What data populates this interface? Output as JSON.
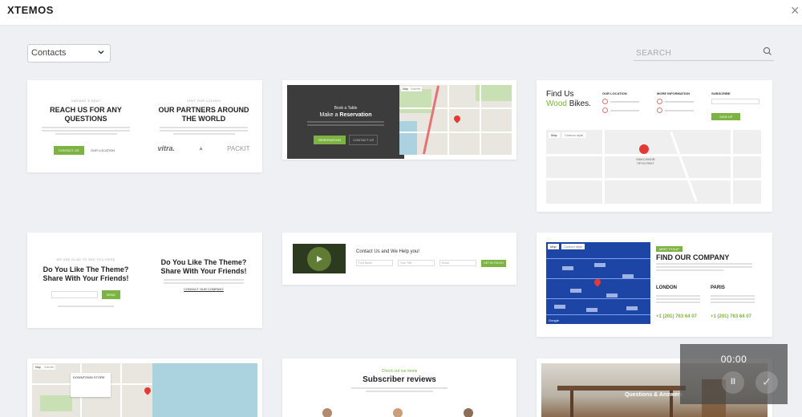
{
  "header": {
    "brand": "XTEMOS",
    "close_glyph": "×"
  },
  "filter": {
    "selected": "Contacts"
  },
  "search": {
    "placeholder": "SEARCH"
  },
  "cards": {
    "c1": {
      "left": {
        "kicker": "VARIANT X-SEAT",
        "title": "REACH US FOR ANY QUESTIONS",
        "primary_btn": "CONTACT US",
        "secondary_btn": "OUR LOCATION"
      },
      "right": {
        "kicker": "VISIT OUR LOCHES",
        "title": "OUR PARTNERS AROUND THE WORLD",
        "logos": [
          "vitra.",
          "▲",
          "PACKIT"
        ]
      }
    },
    "c2": {
      "small": "Book a Table",
      "title_pre": "Make a ",
      "title_bold": "Reservation",
      "btn1": "RESERVATION",
      "btn2": "CONTACT US",
      "map_tab1": "Map",
      "map_tab2": "Satellite"
    },
    "c3": {
      "title_line1": "Find Us",
      "title_green": "Wood",
      "title_rest": " Bikes.",
      "col1": "OUR LOCATION",
      "col2": "MORE INFORMATION",
      "col3": "SUBSCRIBE",
      "subscribe_btn": "SIGN UP",
      "map_tab1": "Map",
      "map_tab2": "Custom style",
      "map_label": "МАКСИМОВ ПРОСПЕКТ"
    },
    "c4": {
      "left": {
        "kicker": "WE ARE GLAD TO SEE YOU HERE",
        "title": "Do You Like The Theme? Share With Your Friends!",
        "btn": "SEND"
      },
      "right": {
        "title": "Do You Like The Theme? Share With Your Friends!",
        "link": "CONSULT OUR COMPANY"
      }
    },
    "c5": {
      "title": "Contact Us and We Help you!",
      "f1": "First Name",
      "f2": "Your Title",
      "f3": "Email",
      "btn": "GET IN TOUCH"
    },
    "c6": {
      "badge": "MEET PHILIP",
      "title": "FIND OUR COMPANY",
      "city1": "LONDON",
      "city2": "PARIS",
      "phone1": "+1 (201) 763 64 07",
      "phone2": "+1 (201) 763 64 07",
      "map_tab1": "Map",
      "map_tab2": "Custom style",
      "google": "Google"
    },
    "c7": {
      "map_tab1": "Map",
      "map_tab2": "Satellite",
      "label": "DOWNTOWN STORE"
    },
    "c8": {
      "kicker": "Check out our items",
      "title": "Subscriber reviews"
    },
    "c9": {
      "title": "Questions & Answers"
    }
  },
  "video": {
    "time": "00:00",
    "pause_glyph": "II",
    "check_glyph": "✓"
  },
  "colors": {
    "accent_green": "#7cb342",
    "page_bg": "#eef0f3",
    "map_blue": "#1d45a5",
    "pin_red": "#e53935"
  }
}
